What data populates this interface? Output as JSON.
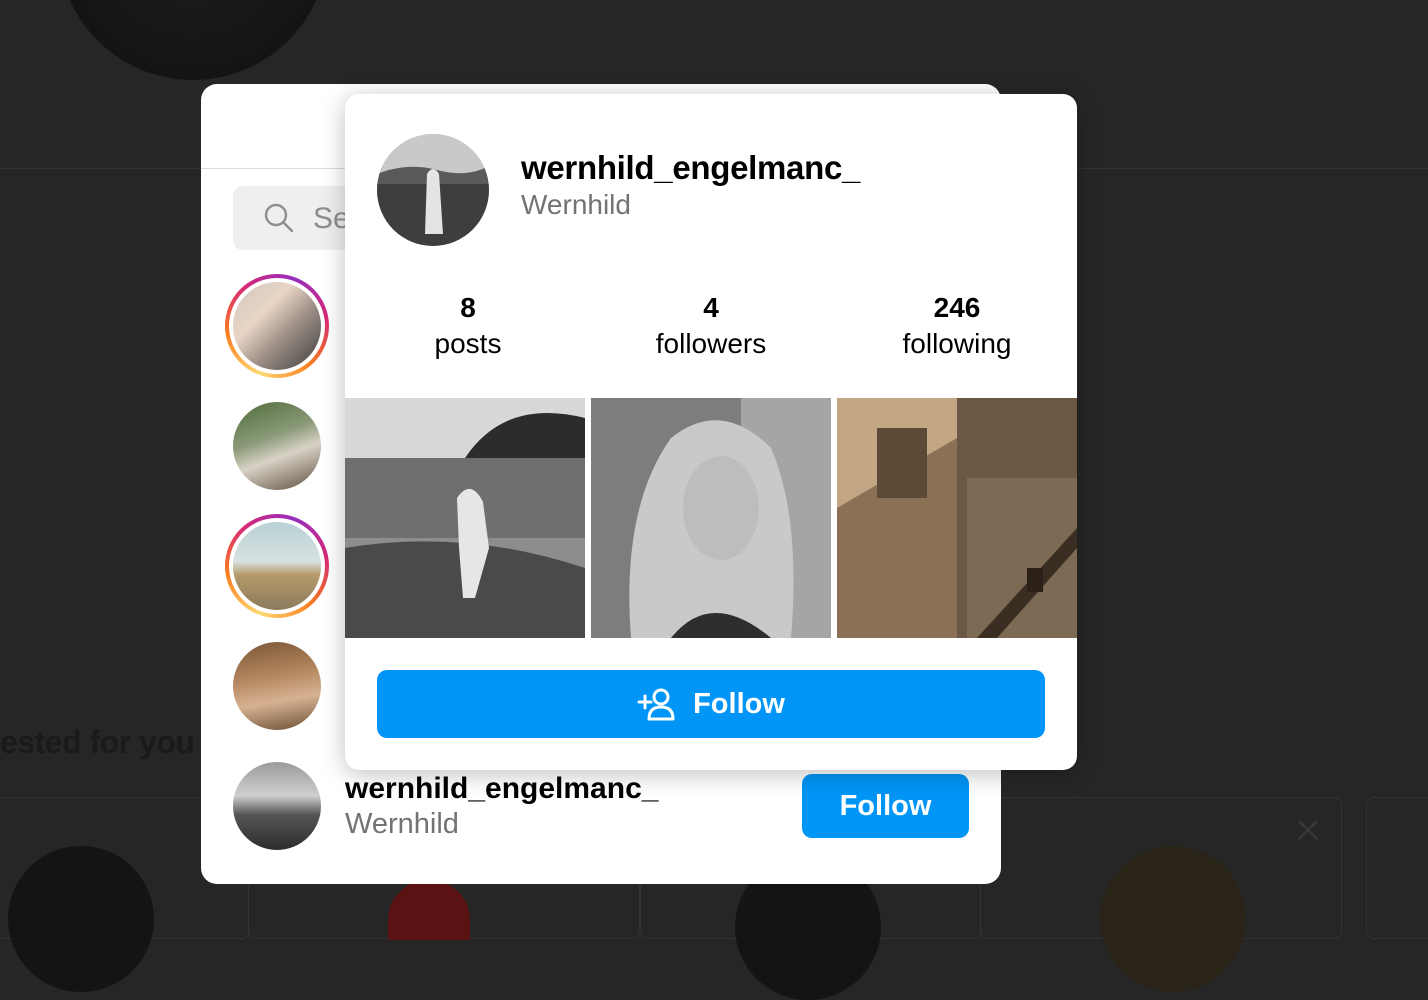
{
  "background": {
    "section_heading": "ested for you"
  },
  "modal": {
    "search": {
      "placeholder": "Se"
    },
    "list_item": {
      "username": "wernhild_engelmanc_",
      "full_name": "Wernhild",
      "follow_label": "Follow"
    }
  },
  "hover_card": {
    "username": "wernhild_engelmanc_",
    "full_name": "Wernhild",
    "stats": [
      {
        "value": "8",
        "label": "posts"
      },
      {
        "value": "4",
        "label": "followers"
      },
      {
        "value": "246",
        "label": "following"
      }
    ],
    "follow_label": "Follow"
  },
  "colors": {
    "primary_blue": "#0095f6",
    "overlay": "#262626",
    "story_gradient": [
      "#feda75",
      "#fa7e1e",
      "#d62976",
      "#962fbf"
    ]
  },
  "icons": {
    "search": "search-icon",
    "follow": "person-add-icon",
    "close": "close-icon"
  }
}
